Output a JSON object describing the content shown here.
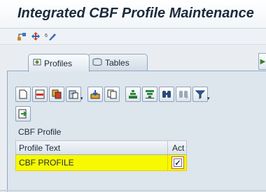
{
  "window": {
    "title": "Integrated CBF Profile Maintenance"
  },
  "app_toolbar": {
    "icons": [
      "hierarchy-icon",
      "move-icon",
      "edit-icon"
    ]
  },
  "tabs": [
    {
      "label": "Profiles",
      "icon": "profiles-icon",
      "active": true
    },
    {
      "label": "Tables",
      "icon": "tables-icon",
      "active": false
    }
  ],
  "alv_toolbar": {
    "icons": [
      "new-icon",
      "delete-row-icon",
      "copy-icon",
      "paste-icon",
      "import-icon",
      "copy-row-icon",
      "sort-ascending-icon",
      "sort-descending-icon",
      "find-icon",
      "find-next-icon",
      "filter-icon"
    ],
    "secondary": "export-icon"
  },
  "section": {
    "label": "CBF Profile"
  },
  "grid": {
    "columns": [
      "Profile Text",
      "Act"
    ],
    "rows": [
      {
        "profile_text": "CBF PROFILE",
        "act": true
      }
    ]
  },
  "colors": {
    "highlight": "#f7f900",
    "accent": "#d25a20"
  }
}
